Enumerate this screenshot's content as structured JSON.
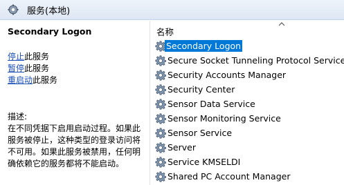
{
  "window": {
    "title": "服务(本地)"
  },
  "left_pane": {
    "service_title": "Secondary Logon",
    "actions": [
      {
        "link": "停止",
        "rest": "此服务"
      },
      {
        "link": "暂停",
        "rest": "此服务"
      },
      {
        "link": "重启动",
        "rest": "此服务"
      }
    ],
    "description_label": "描述:",
    "description": "在不同凭据下启用启动过程。如果此服务被停止，这种类型的登录访问将不可用。如果此服务被禁用，任何明确依赖它的服务都将不能启动。"
  },
  "list": {
    "column_name": "名称",
    "items": [
      {
        "name": "Secondary Logon",
        "selected": true
      },
      {
        "name": "Secure Socket Tunneling Protocol Service",
        "selected": false
      },
      {
        "name": "Security Accounts Manager",
        "selected": false
      },
      {
        "name": "Security Center",
        "selected": false
      },
      {
        "name": "Sensor Data Service",
        "selected": false
      },
      {
        "name": "Sensor Monitoring Service",
        "selected": false
      },
      {
        "name": "Sensor Service",
        "selected": false
      },
      {
        "name": "Server",
        "selected": false
      },
      {
        "name": "Service KMSELDI",
        "selected": false
      },
      {
        "name": "Shared PC Account Manager",
        "selected": false
      }
    ]
  },
  "colors": {
    "accent": "#0078d7",
    "link": "#1a4fb8",
    "titlebar": "#dde7f3"
  },
  "icons": {
    "title": "services-gear-icon",
    "row": "gear-icon",
    "sort": "chevron-up-icon"
  }
}
